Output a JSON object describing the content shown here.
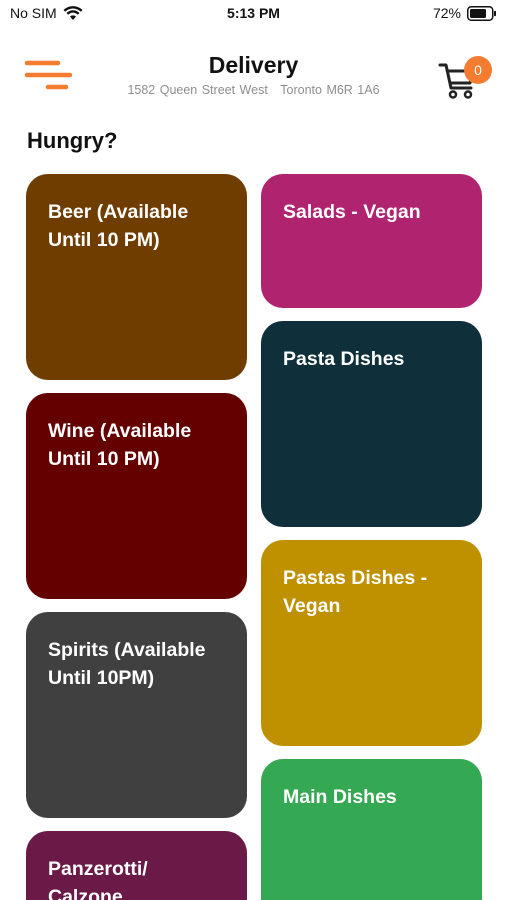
{
  "status_bar": {
    "carrier": "No SIM",
    "time": "5:13 PM",
    "battery": "72%"
  },
  "header": {
    "title": "Delivery",
    "address_street": "1582 Queen Street West",
    "address_city": "Toronto M6R 1A6",
    "cart_count": "0",
    "menu_icon": "hamburger-menu-icon",
    "cart_icon": "shopping-cart-icon",
    "accent_color": "#f47c31"
  },
  "section": {
    "title": "Hungry?"
  },
  "categories": [
    {
      "label": "Beer (Available Until 10 PM)",
      "color": "#6f3d00"
    },
    {
      "label": "Salads - Vegan",
      "color": "#b0246f"
    },
    {
      "label": "Pasta Dishes",
      "color": "#0f2f3a"
    },
    {
      "label": "Wine (Available Until 10 PM)",
      "color": "#640000"
    },
    {
      "label": "Pastas Dishes - Vegan",
      "color": "#bf9000"
    },
    {
      "label": "Spirits (Available Until 10PM)",
      "color": "#404040"
    },
    {
      "label": "Main Dishes",
      "color": "#34a853"
    },
    {
      "label": "Panzerotti/ Calzone",
      "color": "#6b1a48"
    }
  ]
}
